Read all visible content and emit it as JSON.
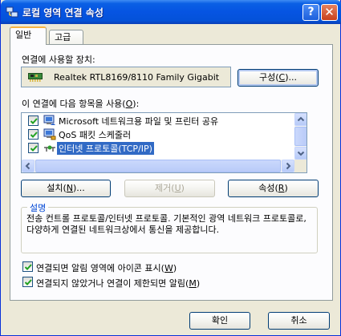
{
  "window": {
    "title": "로컬 영역 연결 속성",
    "help_label": "?",
    "close_label": "✕"
  },
  "tabs": [
    {
      "label": "일반"
    },
    {
      "label": "고급"
    }
  ],
  "device": {
    "label": "연결에 사용할 장치:",
    "name": "Realtek RTL8169/8110 Family Gigabit",
    "configure_button": {
      "pre": "구성(",
      "key": "C",
      "post": ")..."
    }
  },
  "items_list": {
    "label_pre": "이 연결에 다음 항목을 사용(",
    "label_key": "O",
    "label_post": "):",
    "items": [
      {
        "label": "Microsoft 네트워크용 파일 및 프린터 공유",
        "checked": true,
        "selected": false
      },
      {
        "label": "QoS 패킷 스케줄러",
        "checked": true,
        "selected": false
      },
      {
        "label": "인터넷 프로토콜(TCP/IP)",
        "checked": true,
        "selected": true
      }
    ]
  },
  "item_buttons": {
    "install": {
      "pre": "설치(",
      "key": "N",
      "post": ")..."
    },
    "remove": {
      "pre": "제거(",
      "key": "U",
      "post": ")"
    },
    "properties": {
      "pre": "속성(",
      "key": "R",
      "post": ")"
    }
  },
  "description": {
    "title": "설명",
    "text": "전송 컨트롤 프로토콜/인터넷 프로토콜. 기본적인 광역 네트워크 프로토콜로, 다양하게 연결된 네트워크상에서 통신을 제공합니다."
  },
  "options": [
    {
      "pre": "연결되면 알림 영역에 아이콘 표시(",
      "key": "W",
      "post": ")",
      "checked": true
    },
    {
      "pre": "연결되지 않았거나 연결이 제한되면 알림(",
      "key": "M",
      "post": ")",
      "checked": true
    }
  ],
  "footer": {
    "ok_label": "확인",
    "cancel_label": "취소"
  },
  "colors": {
    "title_bar": "#0654e2",
    "selection": "#316ac5",
    "group_title": "#0046d5",
    "face": "#ece9d8"
  }
}
